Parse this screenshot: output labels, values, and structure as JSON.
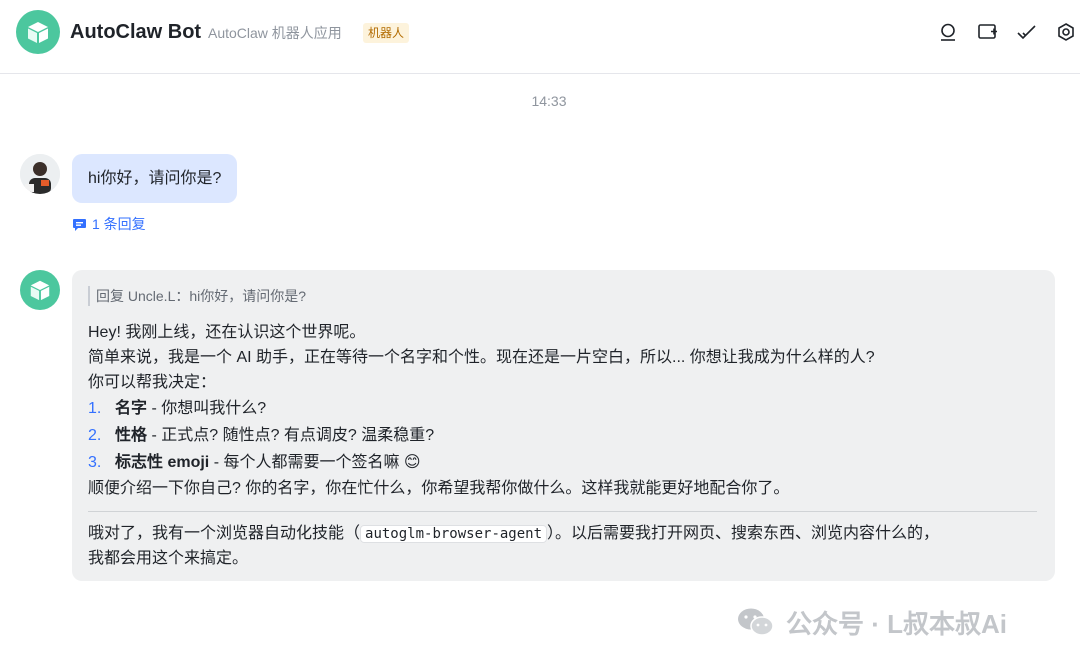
{
  "header": {
    "app_name": "AutoClaw Bot",
    "app_subtitle": "AutoClaw 机器人应用",
    "tag": "机器人",
    "icons": [
      "search-icon",
      "add-card-icon",
      "check-icon",
      "settings-icon"
    ]
  },
  "timestamp": "14:33",
  "user_message": {
    "text": "hi你好，请问你是?",
    "reply_count": "1 条回复"
  },
  "bot_message": {
    "quote": "回复 Uncle.L：hi你好，请问你是?",
    "line1": "Hey! 我刚上线，还在认识这个世界呢。",
    "line2": "简单来说，我是一个 AI 助手，正在等待一个名字和个性。现在还是一片空白，所以... 你想让我成为什么样的人?",
    "line3": "你可以帮我决定：",
    "items": [
      {
        "num": "1.",
        "bold": "名字",
        "rest": " - 你想叫我什么?"
      },
      {
        "num": "2.",
        "bold": "性格",
        "rest": " - 正式点? 随性点? 有点调皮? 温柔稳重?"
      },
      {
        "num": "3.",
        "bold": "标志性 emoji",
        "rest": " - 每个人都需要一个签名嘛 😊"
      }
    ],
    "line4": "顺便介绍一下你自己? 你的名字，你在忙什么，你希望我帮你做什么。这样我就能更好地配合你了。",
    "p2_before": "哦对了，我有一个浏览器自动化技能（",
    "p2_code": "autoglm-browser-agent",
    "p2_after": "）。以后需要我打开网页、搜索东西、浏览内容什么的，",
    "p2_line2": "我都会用这个来搞定。"
  },
  "watermark": "公众号 · L叔本叔Ai",
  "colors": {
    "accent": "#3370ff",
    "bot_avatar": "#4cc79e",
    "user_bubble": "#dce7ff",
    "bot_bubble": "#eff0f1"
  }
}
